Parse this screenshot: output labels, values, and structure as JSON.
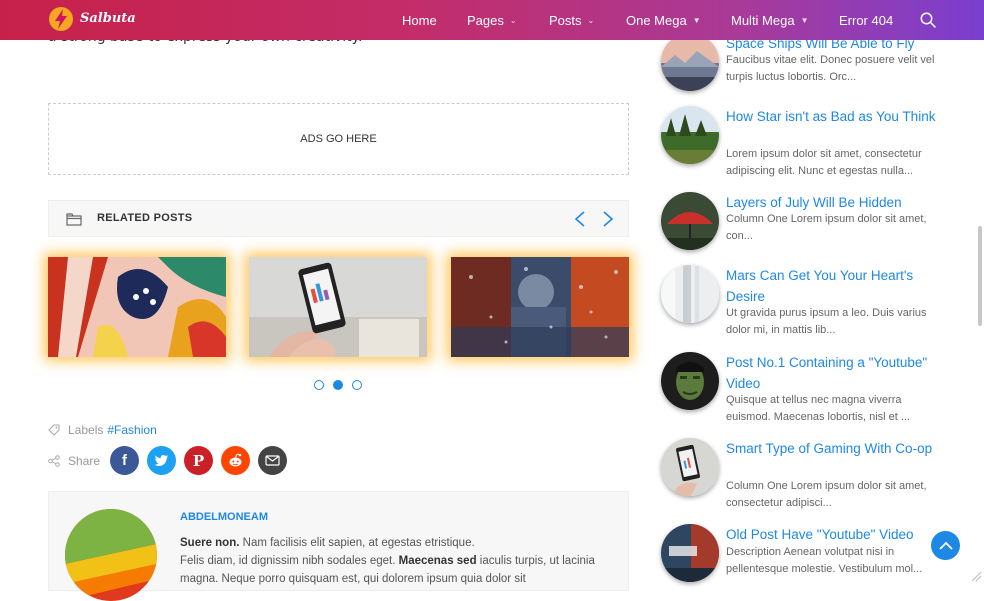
{
  "header": {
    "logo_text": "Salbuta",
    "nav": [
      {
        "label": "Home",
        "caret": ""
      },
      {
        "label": "Pages",
        "caret": "chevron"
      },
      {
        "label": "Posts",
        "caret": "chevron"
      },
      {
        "label": "One Mega",
        "caret": "triangle"
      },
      {
        "label": "Multi Mega",
        "caret": "triangle"
      },
      {
        "label": "Error 404",
        "caret": ""
      }
    ],
    "search_icon": "search-icon"
  },
  "content": {
    "lead_fragment": "a strong base to express your own creativity.",
    "ads_text": "ADS GO HERE",
    "related_title": "RELATED POSTS",
    "carousel_active_index": 1,
    "carousel_dot_count": 3,
    "labels_label": "Labels",
    "labels_link": "#Fashion",
    "share_label": "Share",
    "share_buttons": [
      "facebook-icon",
      "twitter-icon",
      "pinterest-icon",
      "reddit-icon",
      "email-icon"
    ]
  },
  "author": {
    "name": "ABDELMONEAM",
    "bio_bold_1": "Suere non.",
    "bio_1": " Nam facilisis elit sapien, at egestas etristique.",
    "bio_2": "Felis diam, id dignissim nibh sodales eget. ",
    "bio_bold_2": "Maecenas sed",
    "bio_3": " iaculis turpis, ut lacinia magna. Neque porro quisquam est, qui dolorem ipsum quia dolor sit"
  },
  "sidebar": {
    "posts": [
      {
        "title": "Space Ships Will Be Able to Fly",
        "summary": "Faucibus vitae elit. Donec posuere velit vel turpis luctus lobortis. Orc..."
      },
      {
        "title": "How Star isn't as Bad as You Think",
        "summary": "Lorem ipsum dolor sit amet, consectetur adipiscing elit. Nunc et egestas nulla..."
      },
      {
        "title": "Layers of July Will Be Hidden",
        "summary": "Column One Lorem ipsum dolor sit amet, con..."
      },
      {
        "title": "Mars Can Get You Your Heart's Desire",
        "summary": "Ut gravida purus ipsum a leo. Duis varius dolor mi, in mattis lib..."
      },
      {
        "title": "Post No.1 Containing a \"Youtube\" Video",
        "summary": "Quisque at tellus nec magna viverra euismod. Maecenas lobortis, nisl et ..."
      },
      {
        "title": "Smart Type of Gaming With Co-op",
        "summary": "Column One Lorem ipsum dolor sit amet, consectetur adipisci..."
      },
      {
        "title": "Old Post Have \"Youtube\" Video",
        "summary": "Description Aenean volutpat nisi in pellentesque molestie. Vestibulum mol..."
      }
    ]
  },
  "colors": {
    "accent": "#1e88e5",
    "header_gradient_start": "#c6214a",
    "header_gradient_end": "#7a3fd0",
    "facebook": "#3b5998",
    "twitter": "#1da1f2",
    "pinterest": "#cb2027",
    "reddit": "#ff4500",
    "email": "#444444"
  }
}
